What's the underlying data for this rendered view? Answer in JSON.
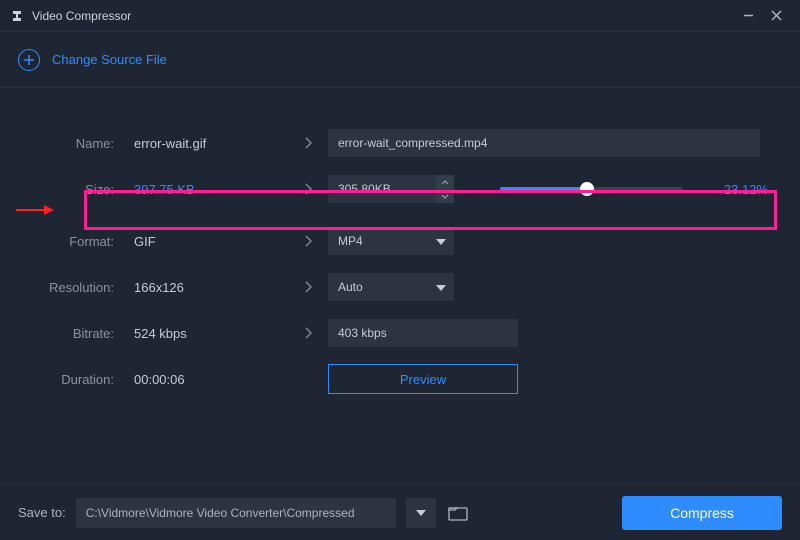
{
  "titlebar": {
    "app_name": "Video Compressor"
  },
  "source": {
    "change_label": "Change Source File"
  },
  "rows": {
    "name": {
      "label": "Name:",
      "value": "error-wait.gif",
      "output": "error-wait_compressed.mp4"
    },
    "size": {
      "label": "Size:",
      "value": "397.75 KB",
      "output_size": "305.80KB",
      "reduction_pct": "-23.12%",
      "slider_fill_pct": 48
    },
    "format": {
      "label": "Format:",
      "value": "GIF",
      "select": "MP4"
    },
    "resolution": {
      "label": "Resolution:",
      "value": "166x126",
      "select": "Auto"
    },
    "bitrate": {
      "label": "Bitrate:",
      "value": "524 kbps",
      "output": "403 kbps"
    },
    "duration": {
      "label": "Duration:",
      "value": "00:00:06"
    }
  },
  "preview": {
    "label": "Preview"
  },
  "footer": {
    "save_label": "Save to:",
    "path": "C:\\Vidmore\\Vidmore Video Converter\\Compressed",
    "compress_label": "Compress"
  }
}
